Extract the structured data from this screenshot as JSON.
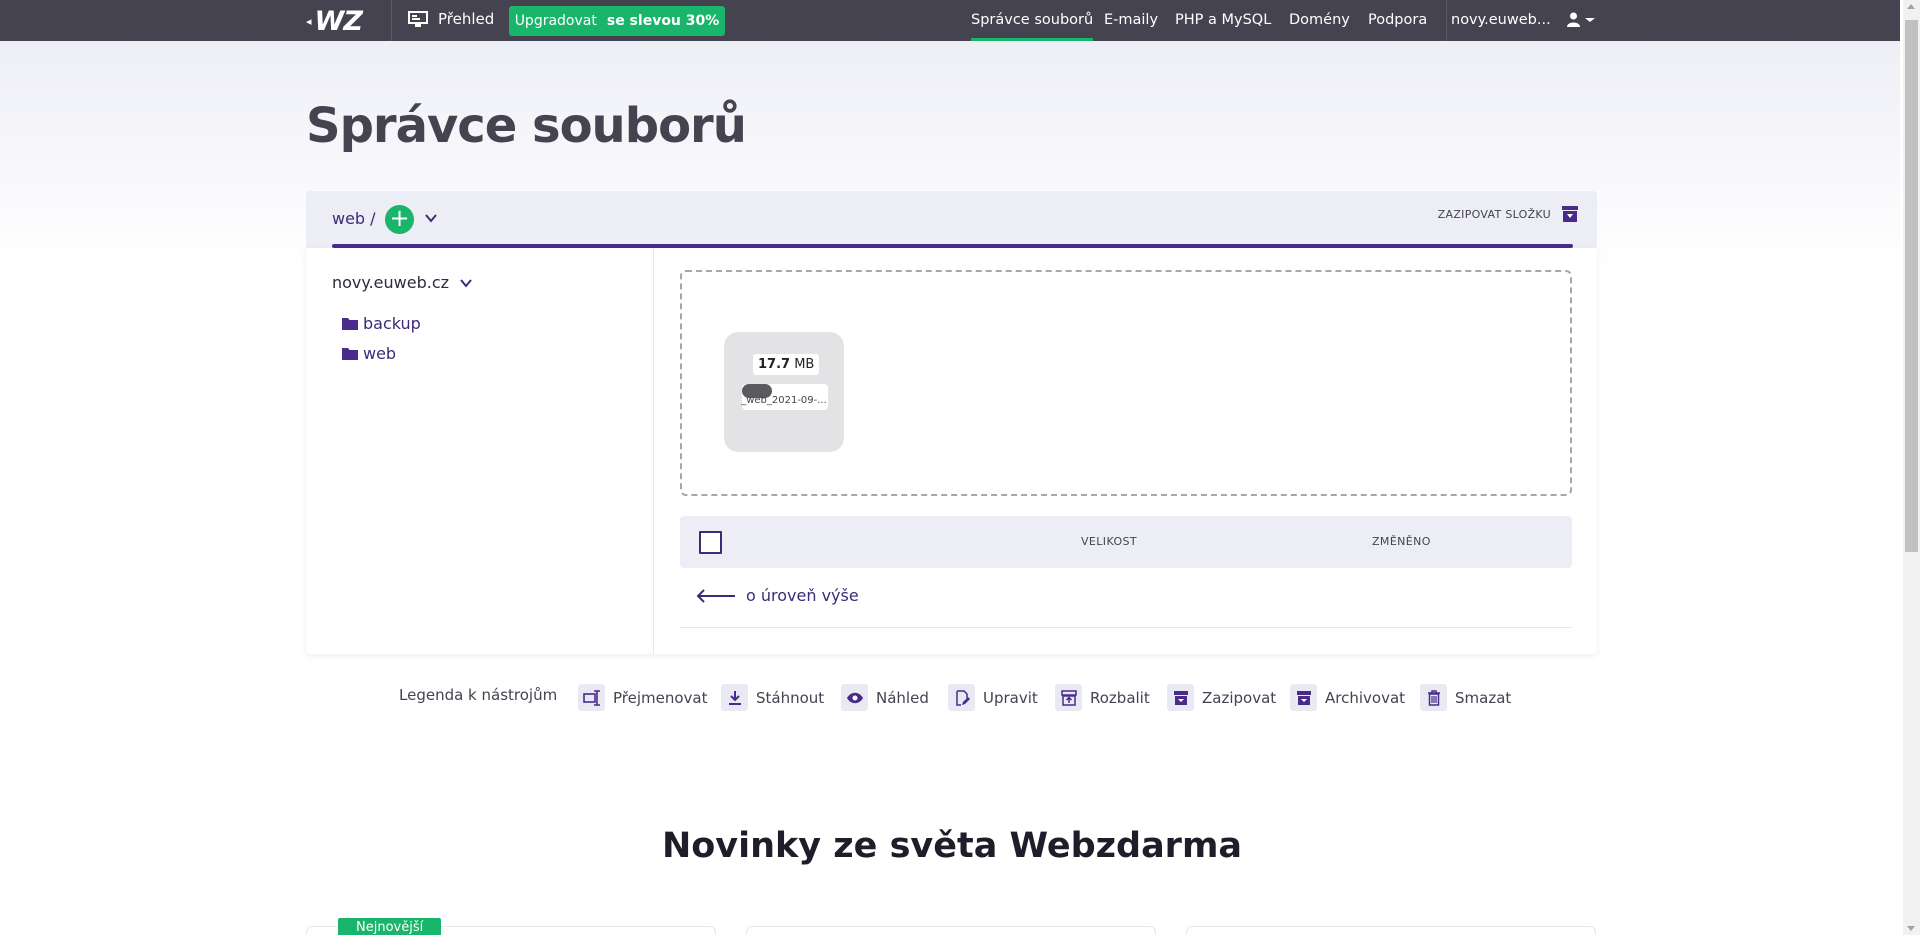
{
  "topbar": {
    "logo_text": "WZ",
    "overview_label": "Přehled",
    "upgrade_label": "Upgradovat",
    "upgrade_discount": "se slevou 30%",
    "nav": [
      "Správce souborů",
      "E-maily",
      "PHP a MySQL",
      "Domény",
      "Podpora"
    ],
    "active_nav": "Správce souborů",
    "account_label": "novy.euweb..."
  },
  "page": {
    "title": "Správce souborů"
  },
  "file_manager": {
    "breadcrumb": "web /",
    "zip_folder_label": "ZAZIPOVAT SLOŽKU",
    "tree": {
      "domain": "novy.euweb.cz",
      "folders": [
        "backup",
        "web"
      ]
    },
    "upload": {
      "size_value": "17.7",
      "size_unit": "MB",
      "file_name": "_web_2021-09-...",
      "progress": 0.35
    },
    "columns": {
      "size": "VELIKOST",
      "modified": "ZMĚNĚNO"
    },
    "up_level_label": "o úroveň výše"
  },
  "legend": {
    "title": "Legenda k nástrojům",
    "tools": [
      "Přejmenovat",
      "Stáhnout",
      "Náhled",
      "Upravit",
      "Rozbalit",
      "Zazipovat",
      "Archivovat",
      "Smazat"
    ]
  },
  "news": {
    "title": "Novinky ze světa Webzdarma",
    "badge": "Nejnovější"
  },
  "colors": {
    "topbar": "#44434f",
    "accent_green": "#19b56a",
    "accent_purple": "#3d2a78"
  }
}
